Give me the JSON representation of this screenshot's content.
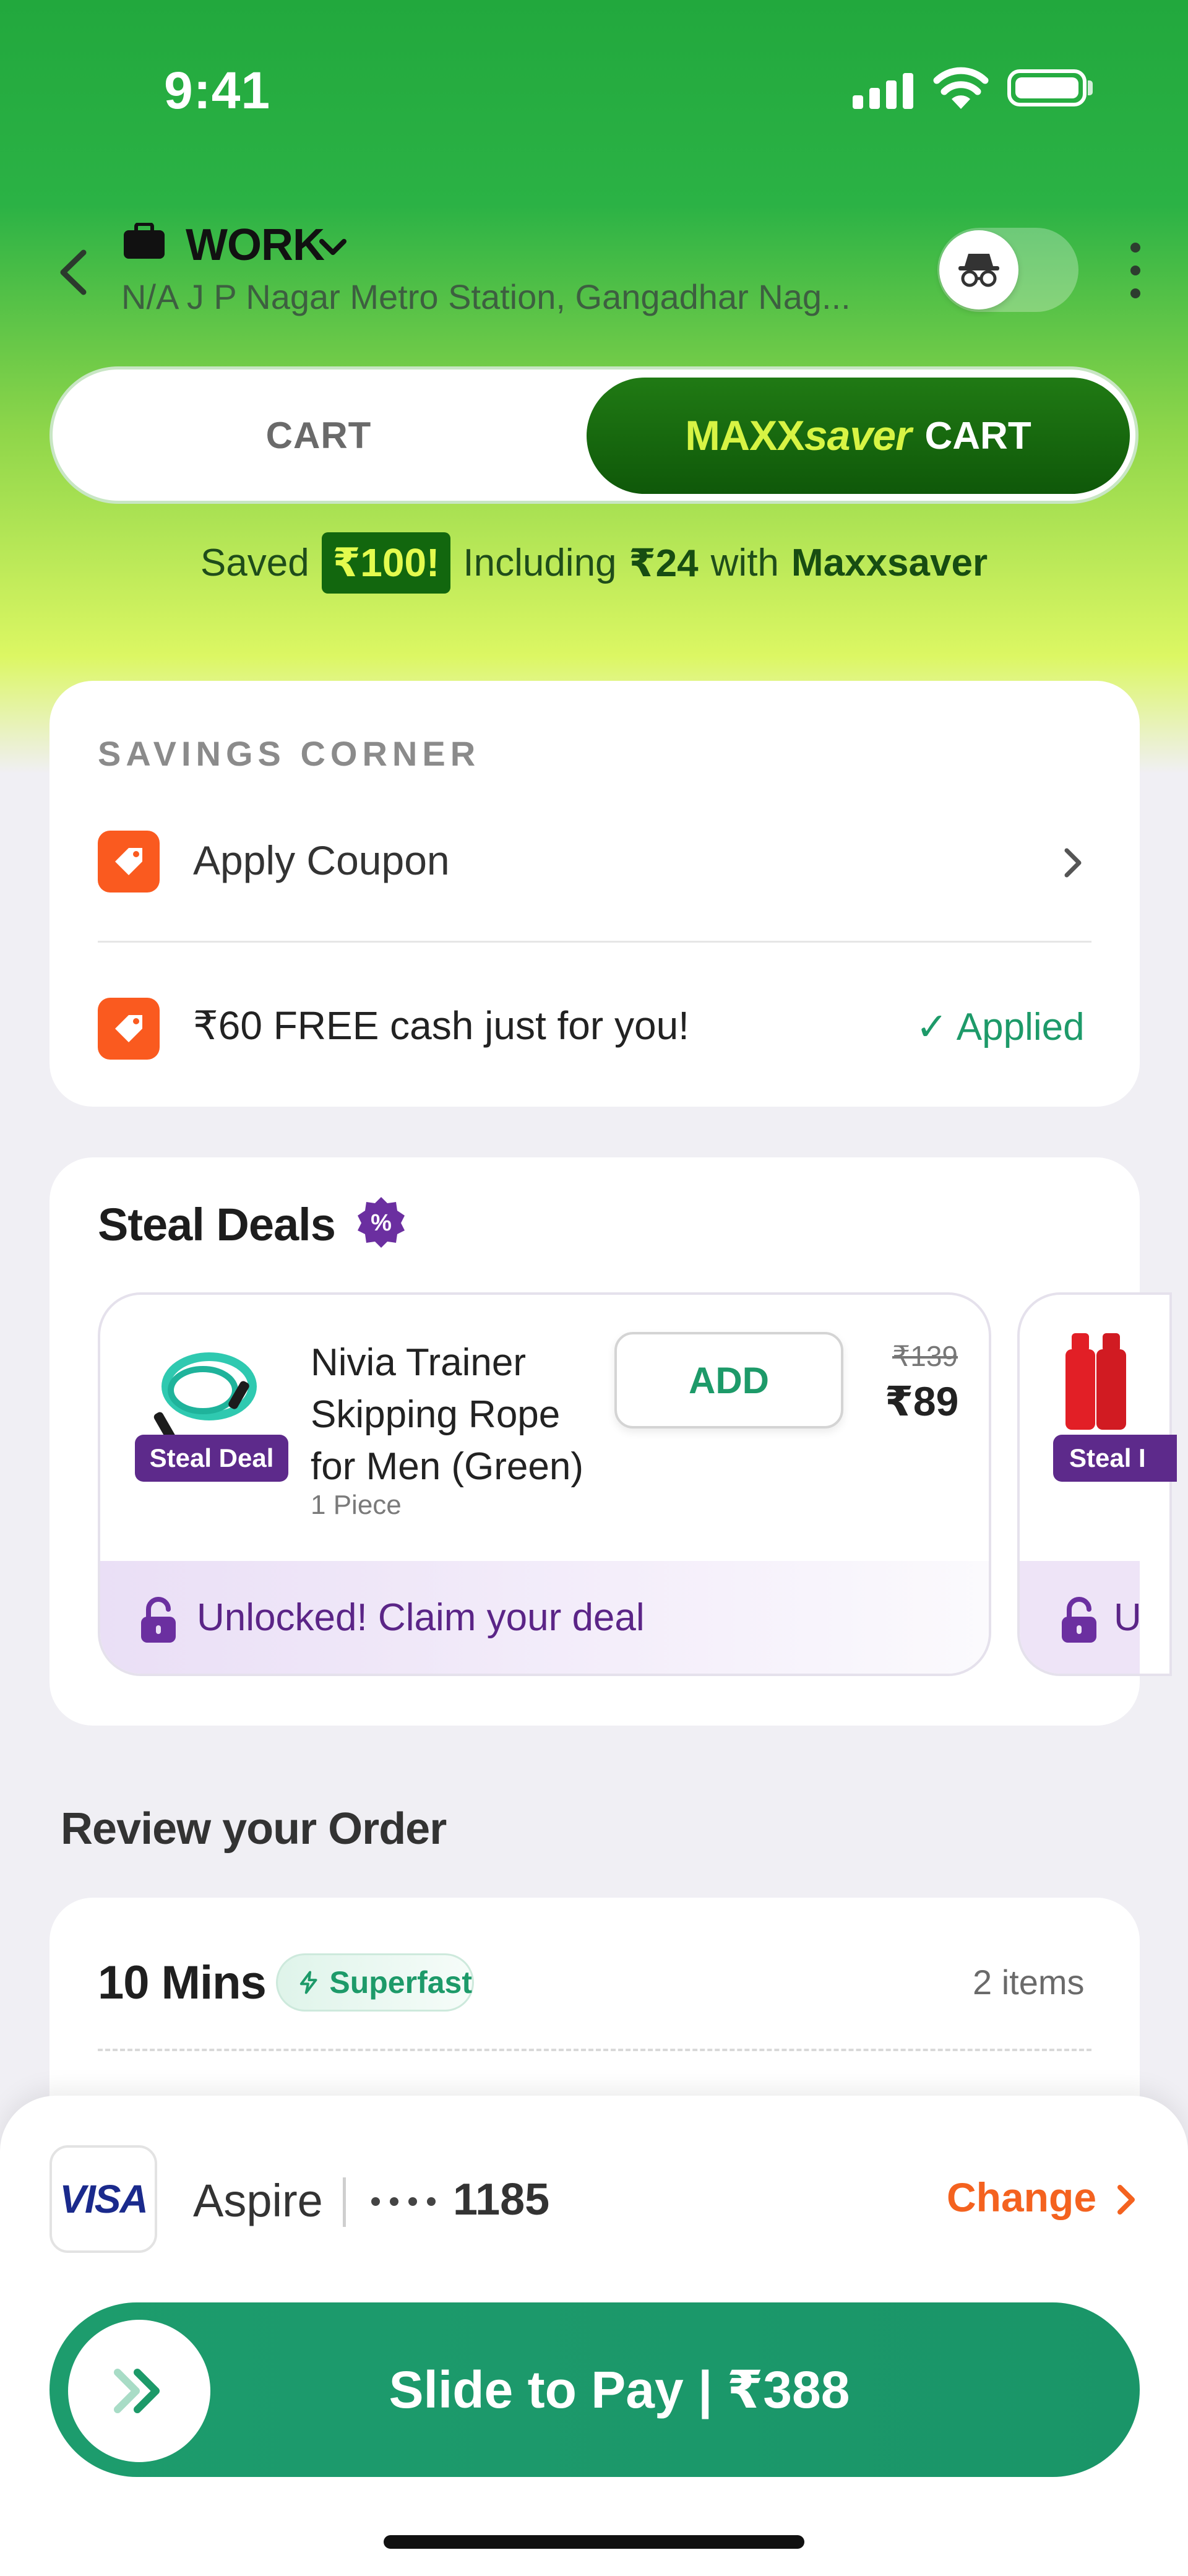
{
  "status_bar": {
    "time": "9:41"
  },
  "header": {
    "location_label": "WORK",
    "address": "N/A J P Nagar Metro Station, Gangadhar Nag..."
  },
  "cart_switch": {
    "tab_cart": "CART",
    "brand_a": "MAXX",
    "brand_b": "saver",
    "tab_maxx_cart": "CART",
    "active_tab": "maxxsaver"
  },
  "savings_banner": {
    "prefix": "Saved",
    "amount": "₹100!",
    "middle": "Including",
    "included_amount": "₹24",
    "with_word": "with",
    "brand": "Maxxsaver"
  },
  "savings_corner": {
    "title": "SAVINGS CORNER",
    "apply_coupon": "Apply Coupon",
    "free_cash": "₹60 FREE cash just for you!",
    "applied": "✓ Applied"
  },
  "steal_deals": {
    "title": "Steal Deals",
    "badge_symbol": "%",
    "deal": {
      "name": "Nivia Trainer Skipping Rope for Men (Green)",
      "quantity": "1 Piece",
      "tag": "Steal Deal",
      "add_label": "ADD",
      "mrp": "₹139",
      "price": "₹89",
      "footer": "Unlocked! Claim your deal"
    },
    "next_deal": {
      "tag": "Steal I",
      "footer": "U"
    }
  },
  "review": {
    "title": "Review your Order",
    "delivery_time": "10 Mins",
    "speed_badge": "Superfast",
    "item_count": "2 items"
  },
  "payment": {
    "card_brand": "VISA",
    "card_name": "Aspire",
    "card_last4": "1185",
    "change_label": "Change",
    "slide_label": "Slide to Pay | ₹388"
  },
  "colors": {
    "primary_green": "#1d9a69",
    "maxx_dark_green": "#0f5809",
    "maxx_yellow": "#d7f444",
    "orange": "#fa5a1f",
    "purple": "#5d2a8b"
  }
}
